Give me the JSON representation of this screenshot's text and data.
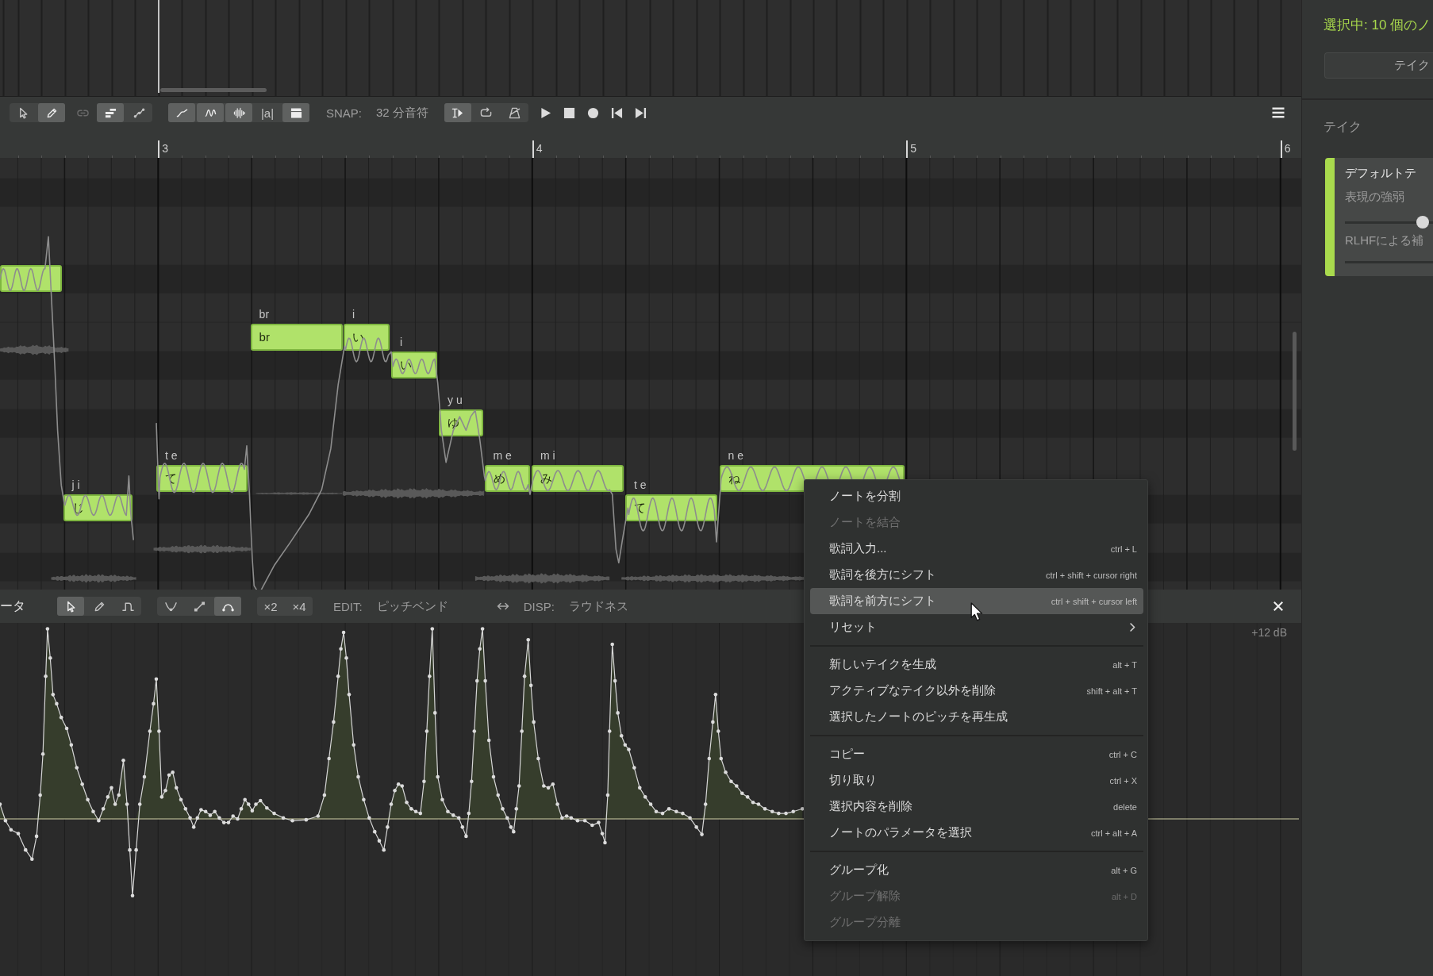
{
  "toolbar": {
    "tool_groups": [
      {
        "buttons": [
          {
            "kind": "select",
            "active": false,
            "disabled": false
          },
          {
            "kind": "pencil",
            "active": true,
            "disabled": false
          }
        ]
      },
      {
        "buttons": [
          {
            "kind": "link",
            "active": false,
            "disabled": true
          }
        ]
      },
      {
        "buttons": [
          {
            "kind": "align",
            "active": true,
            "disabled": false
          },
          {
            "kind": "nodes",
            "active": false,
            "disabled": false
          }
        ]
      },
      {
        "buttons": [
          {
            "kind": "curve",
            "active": true,
            "disabled": false
          },
          {
            "kind": "wave",
            "active": true,
            "disabled": false
          },
          {
            "kind": "waveform",
            "active": true,
            "disabled": false
          },
          {
            "kind": "phoneme",
            "label": "|a|",
            "active": false,
            "disabled": false
          },
          {
            "kind": "clapper",
            "active": true,
            "disabled": false
          }
        ]
      }
    ],
    "snap": {
      "label": "SNAP:",
      "value": "32 分音符"
    },
    "playback_group": {
      "buttons": [
        {
          "kind": "cursor-play",
          "active": true,
          "disabled": false
        },
        {
          "kind": "loop",
          "active": false,
          "disabled": false
        },
        {
          "kind": "metronome",
          "active": false,
          "disabled": false
        }
      ]
    }
  },
  "ruler": {
    "bars": [
      "3",
      "4",
      "5",
      "6"
    ]
  },
  "notes": [
    {
      "selected": true
    },
    {
      "phonemes": "j i",
      "lyric": "じ",
      "selected": true
    },
    {
      "phonemes": "t e",
      "lyric": "て",
      "selected": true
    },
    {
      "phonemes": "br",
      "lyric": "br",
      "selected": true
    },
    {
      "phonemes": "i",
      "lyric": "い",
      "selected": true
    },
    {
      "phonemes": "i",
      "lyric": "い",
      "selected": true
    },
    {
      "phonemes": "y u",
      "lyric": "ゆ",
      "selected": true
    },
    {
      "phonemes": "m e",
      "lyric": "め",
      "selected": true
    },
    {
      "phonemes": "m i",
      "lyric": "み",
      "selected": true
    },
    {
      "phonemes": "t e",
      "lyric": "て",
      "selected": true
    },
    {
      "phonemes": "n e",
      "lyric": "ね",
      "selected": true
    }
  ],
  "parameter_panel": {
    "title": "ータ",
    "tool_groups": [
      {
        "buttons": [
          {
            "kind": "select",
            "active": true,
            "disabled": false
          },
          {
            "kind": "pencil",
            "active": false,
            "disabled": false
          },
          {
            "kind": "step",
            "active": false,
            "disabled": false
          }
        ]
      },
      {
        "buttons": [
          {
            "kind": "v-curve",
            "active": false,
            "disabled": false
          },
          {
            "kind": "ramp",
            "active": false,
            "disabled": false
          },
          {
            "kind": "arch",
            "active": true,
            "disabled": false
          }
        ]
      },
      {
        "buttons": [
          {
            "kind": "multiplier",
            "label": "×2",
            "active": false,
            "disabled": false
          },
          {
            "kind": "multiplier",
            "label": "×4",
            "active": false,
            "disabled": false
          }
        ]
      }
    ],
    "edit": {
      "label": "EDIT:",
      "value": "ピッチベンド"
    },
    "display": {
      "label": "DISP:",
      "value": "ラウドネス"
    },
    "scale_label": "+12 dB"
  },
  "context_menu": {
    "groups": [
      {
        "items": [
          {
            "label": "ノートを分割",
            "disabled": false,
            "highlighted": false,
            "submenu": false
          },
          {
            "label": "ノートを結合",
            "disabled": true,
            "highlighted": false,
            "submenu": false
          },
          {
            "label": "歌詞入力...",
            "shortcut": "ctrl + L",
            "disabled": false,
            "highlighted": false,
            "submenu": false
          },
          {
            "label": "歌詞を後方にシフト",
            "shortcut": "ctrl + shift + cursor right",
            "disabled": false,
            "highlighted": false,
            "submenu": false
          },
          {
            "label": "歌詞を前方にシフト",
            "shortcut": "ctrl + shift + cursor left",
            "disabled": false,
            "highlighted": true,
            "submenu": false
          },
          {
            "label": "リセット",
            "disabled": false,
            "highlighted": false,
            "submenu": true
          }
        ]
      },
      {
        "items": [
          {
            "label": "新しいテイクを生成",
            "shortcut": "alt + T",
            "disabled": false,
            "highlighted": false,
            "submenu": false
          },
          {
            "label": "アクティブなテイク以外を削除",
            "shortcut": "shift + alt + T",
            "disabled": false,
            "highlighted": false,
            "submenu": false
          },
          {
            "label": "選択したノートのピッチを再生成",
            "disabled": false,
            "highlighted": false,
            "submenu": false
          }
        ]
      },
      {
        "items": [
          {
            "label": "コピー",
            "shortcut": "ctrl + C",
            "disabled": false,
            "highlighted": false,
            "submenu": false
          },
          {
            "label": "切り取り",
            "shortcut": "ctrl + X",
            "disabled": false,
            "highlighted": false,
            "submenu": false
          },
          {
            "label": "選択内容を削除",
            "shortcut": "delete",
            "disabled": false,
            "highlighted": false,
            "submenu": false
          },
          {
            "label": "ノートのパラメータを選択",
            "shortcut": "ctrl + alt + A",
            "disabled": false,
            "highlighted": false,
            "submenu": false
          }
        ]
      },
      {
        "items": [
          {
            "label": "グループ化",
            "shortcut": "alt + G",
            "disabled": false,
            "highlighted": false,
            "submenu": false
          },
          {
            "label": "グループ解除",
            "shortcut": "alt + D",
            "disabled": true,
            "highlighted": false,
            "submenu": false
          },
          {
            "label": "グループ分離",
            "disabled": true,
            "highlighted": false,
            "submenu": false
          }
        ]
      }
    ]
  },
  "side_panel": {
    "selection": "選択中: 10 個のノ",
    "take_button": "テイク",
    "takes_heading": "テイク",
    "takes": [
      {
        "name": "デフォルトテ",
        "active": true,
        "sliders": [
          {
            "label": "表現の強弱",
            "level": 0.95
          },
          {
            "label": "RLHFによる補"
          }
        ]
      }
    ]
  }
}
